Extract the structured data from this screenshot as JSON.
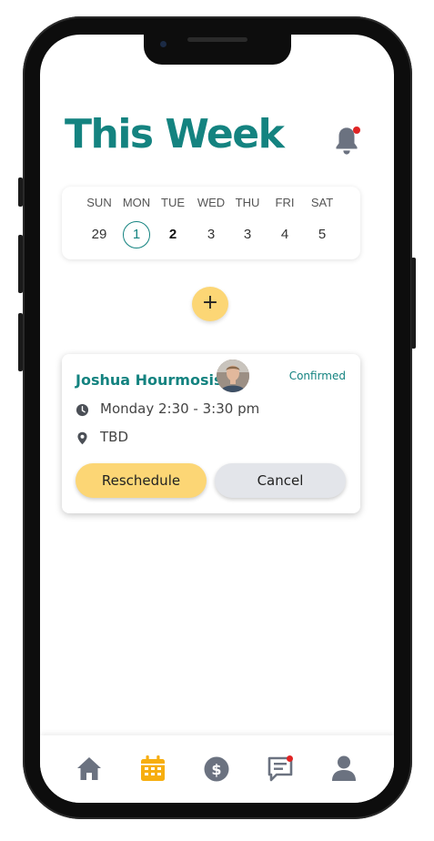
{
  "header": {
    "title": "This Week",
    "notification_icon": "bell-icon",
    "has_unread": true
  },
  "calendar": {
    "days": [
      {
        "name": "SUN",
        "num": "29"
      },
      {
        "name": "MON",
        "num": "1"
      },
      {
        "name": "TUE",
        "num": "2"
      },
      {
        "name": "WED",
        "num": "3"
      },
      {
        "name": "THU",
        "num": "3"
      },
      {
        "name": "FRI",
        "num": "4"
      },
      {
        "name": "SAT",
        "num": "5"
      }
    ],
    "selected_index": 1,
    "today_index": 2
  },
  "add_button": {
    "label": "+"
  },
  "appointment": {
    "name": "Joshua Hourmosis",
    "status": "Confirmed",
    "time": "Monday 2:30 - 3:30 pm",
    "location": "TBD",
    "reschedule_label": "Reschedule",
    "cancel_label": "Cancel"
  },
  "tabbar": {
    "items": [
      {
        "name": "home",
        "icon": "home-icon",
        "active": false
      },
      {
        "name": "calendar",
        "icon": "calendar-icon",
        "active": true
      },
      {
        "name": "payments",
        "icon": "dollar-icon",
        "active": false
      },
      {
        "name": "messages",
        "icon": "chat-icon",
        "active": false,
        "badge": true
      },
      {
        "name": "profile",
        "icon": "user-icon",
        "active": false
      }
    ]
  },
  "colors": {
    "accent": "#148380",
    "yellow": "#fcd675",
    "active_tab": "#f7ae0f",
    "inactive_tab": "#6b7280",
    "badge": "#e02424"
  }
}
